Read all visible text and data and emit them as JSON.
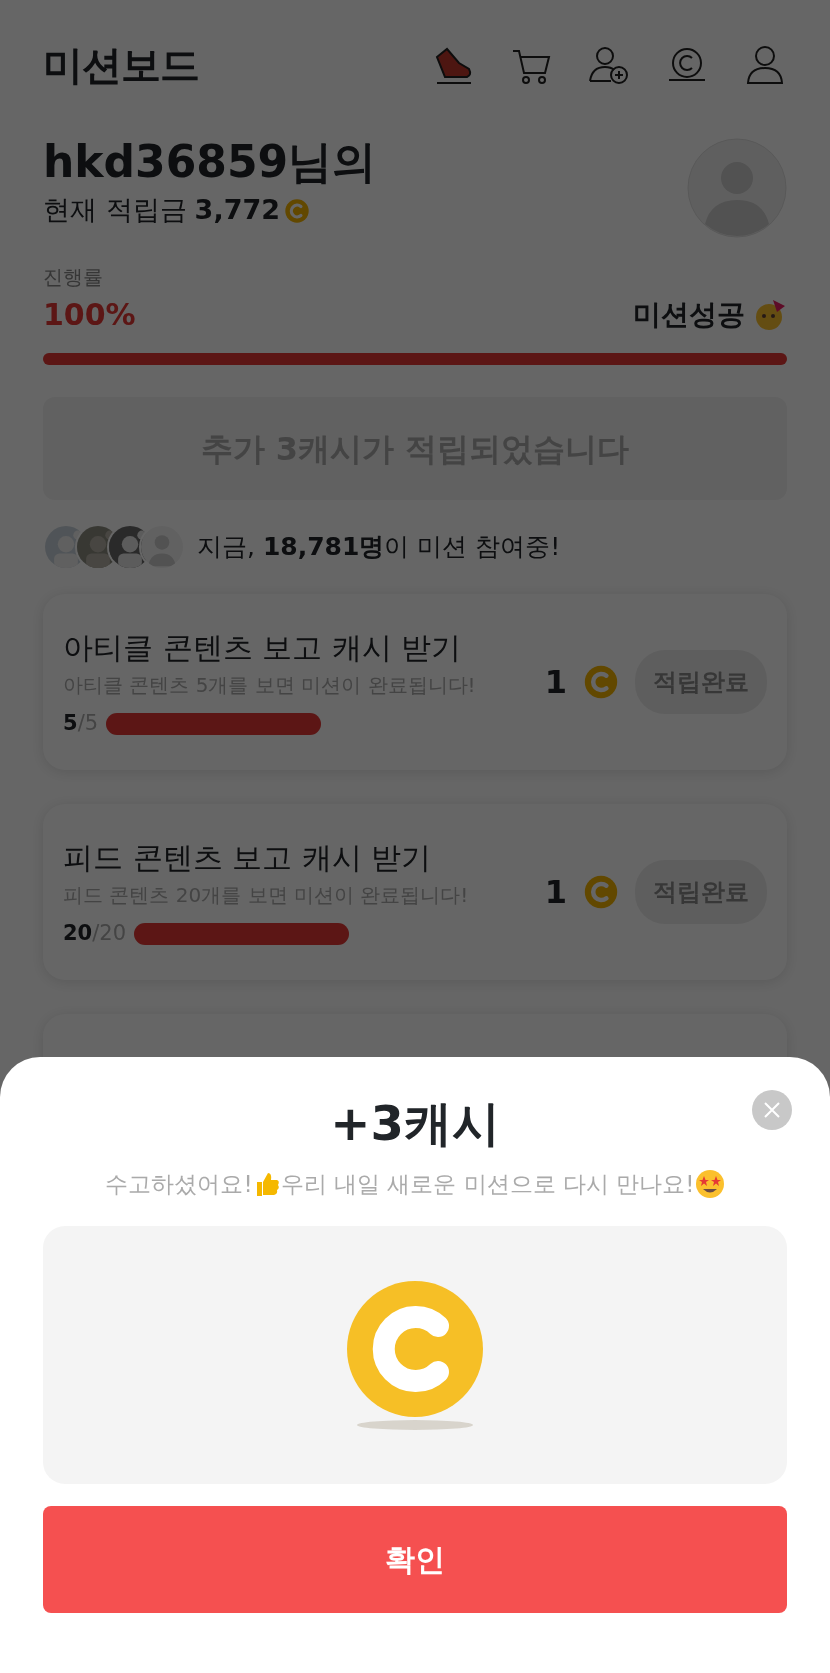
{
  "header": {
    "logo": "미션보드"
  },
  "profile": {
    "greeting": "hkd36859님의",
    "balance_label": "현재 적립금",
    "balance": "3,772"
  },
  "progress": {
    "label": "진행률",
    "percent": "100%",
    "level": 1,
    "status": "미션성공"
  },
  "banner": {
    "text": "추가 3캐시가 적립되었습니다"
  },
  "participants": {
    "prefix": "지금, ",
    "count": "18,781명",
    "suffix": "이 미션 참여중!"
  },
  "missions": [
    {
      "title": "아티클 콘텐츠 보고 캐시 받기",
      "description": "아티클 콘텐츠 5개를 보면 미션이 완료됩니다!",
      "current": "5",
      "total": "/5",
      "level": 1,
      "reward": "1",
      "button": "적립완료",
      "completed": true
    },
    {
      "title": "피드 콘텐츠 보고 캐시 받기",
      "description": "피드 콘텐츠 20개를 보면 미션이 완료됩니다!",
      "current": "20",
      "total": "/20",
      "level": 1,
      "reward": "1",
      "button": "적립완료",
      "completed": true
    }
  ],
  "sheet": {
    "title": "+3캐시",
    "message_start": "수고하셨어요!",
    "message_end": " 우리 내일 새로운 미션으로 다시 만나요!",
    "confirm": "확인"
  }
}
